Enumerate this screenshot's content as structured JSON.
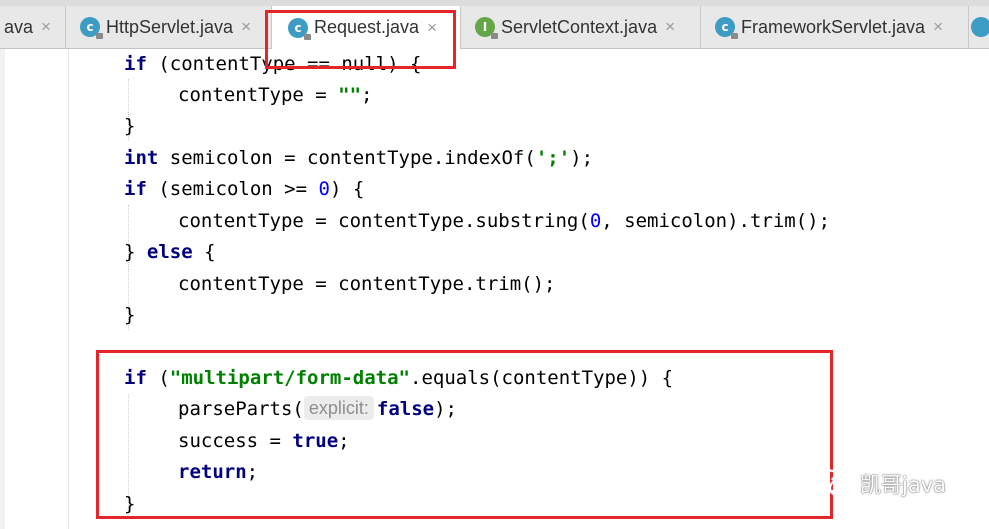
{
  "tabs": [
    {
      "label": "ava",
      "icon": "none",
      "active": false
    },
    {
      "label": "HttpServlet.java",
      "icon": "class-icon",
      "active": false
    },
    {
      "label": "Request.java",
      "icon": "class-icon",
      "active": true
    },
    {
      "label": "ServletContext.java",
      "icon": "interface-icon",
      "active": false
    },
    {
      "label": "FrameworkServlet.java",
      "icon": "class-icon",
      "active": false
    }
  ],
  "close_glyph": "×",
  "icon_letters": {
    "class": "c",
    "interface": "I"
  },
  "code": {
    "l1": {
      "kw": "if",
      "rest": " (contentType == null) {"
    },
    "l2": {
      "text": "contentType = ",
      "str": "\"\"",
      "end": ";"
    },
    "l3": {
      "text": "}"
    },
    "l4": {
      "kw": "int",
      "rest": " semicolon = contentType.indexOf(",
      "str": "';'",
      "end": ");"
    },
    "l5": {
      "kw": "if",
      "a": " (semicolon >= ",
      "num": "0",
      "b": ") {"
    },
    "l6": {
      "a": "contentType = contentType.substring(",
      "num": "0",
      "b": ", semicolon).trim();"
    },
    "l7": {
      "a": "} ",
      "kw": "else",
      "b": " {"
    },
    "l8": {
      "text": "contentType = contentType.trim();"
    },
    "l9": {
      "text": "}"
    },
    "l10": {
      "kw": "if",
      "a": " (",
      "str": "\"multipart/form-data\"",
      "b": ".equals(contentType)) {"
    },
    "l11": {
      "a": "parseParts(",
      "hint": "explicit:",
      "kw": "false",
      "b": ");"
    },
    "l12": {
      "a": "success = ",
      "kw": "true",
      "b": ";"
    },
    "l13": {
      "kw": "return",
      "b": ";"
    },
    "l14": {
      "text": "}"
    }
  },
  "watermark": {
    "text": "凯哥java",
    "icon": "wechat-icon"
  },
  "colors": {
    "keyword": "#000080",
    "string": "#008000",
    "number": "#0000ff",
    "highlight_box": "#e5252a"
  }
}
